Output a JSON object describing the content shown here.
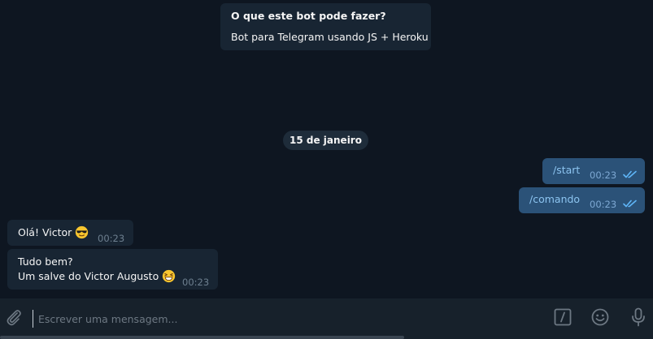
{
  "bot_info": {
    "title": "O que este bot pode fazer?",
    "description": "Bot para Telegram usando JS + Heroku"
  },
  "date_separator": "15 de janeiro",
  "messages": [
    {
      "direction": "out",
      "text": "/start",
      "time": "00:23",
      "status": "read"
    },
    {
      "direction": "out",
      "text": "/comando",
      "time": "00:23",
      "status": "read"
    },
    {
      "direction": "in",
      "text": "Olá! Victor",
      "emoji": "sunglasses-emoji",
      "time": "00:23"
    },
    {
      "direction": "in",
      "line1": "Tudo bem?",
      "line2": "Um salve do Victor Augusto",
      "emoji": "grinning-squinting-emoji",
      "time": "00:23"
    }
  ],
  "composer": {
    "placeholder": "Escrever uma mensagem...",
    "value": "",
    "icons": [
      "paperclip-icon",
      "bot-command-icon",
      "emoji-smile-icon",
      "microphone-icon"
    ]
  },
  "colors": {
    "background": "#0e1621",
    "incoming_bubble": "#182533",
    "outgoing_bubble": "#2b5278",
    "composer": "#17212b",
    "accent": "#5eb5f7"
  }
}
